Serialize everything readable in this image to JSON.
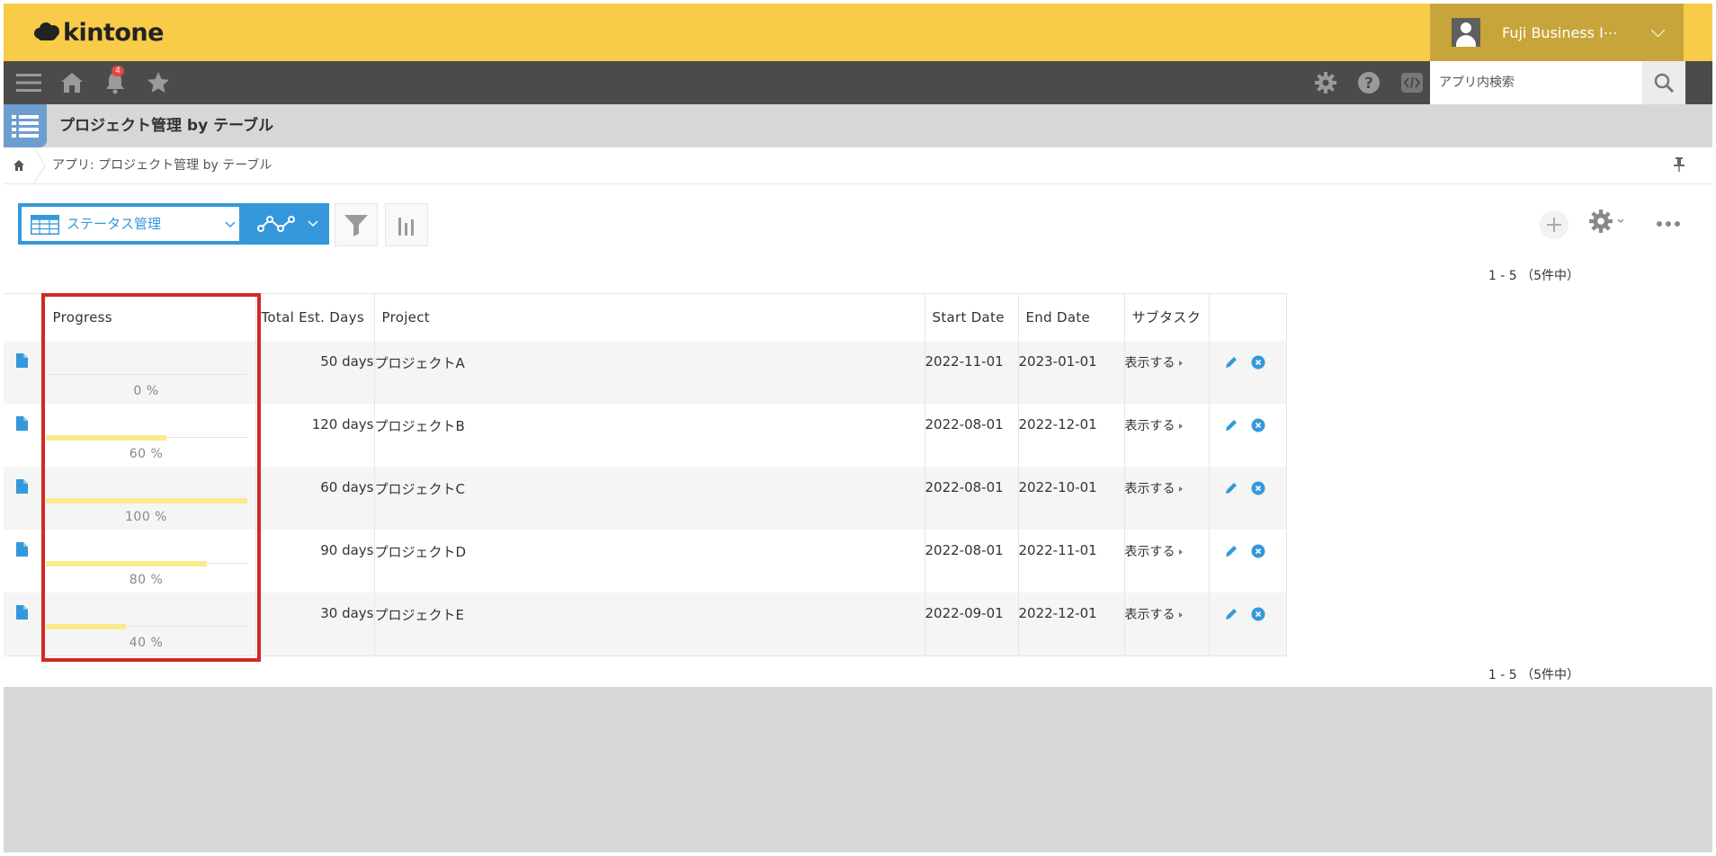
{
  "app": {
    "logo_text": "kintone",
    "user_name": "Fuji Business I⋯",
    "notification_count": "4",
    "search_placeholder": "アプリ内検索",
    "title": "プロジェクト管理 by テーブル",
    "breadcrumb": "アプリ: プロジェクト管理 by テーブル",
    "accent_color": "#3498db",
    "header_color": "#f8cb48"
  },
  "toolbar": {
    "view_label": "ステータス管理",
    "pager_top": "1 - 5 （5件中）",
    "pager_bottom": "1 - 5 （5件中）"
  },
  "table": {
    "columns": [
      "Progress",
      "Total Est. Days",
      "Project",
      "Start Date",
      "End Date",
      "サブタスク"
    ],
    "rows": [
      {
        "progress": 0,
        "progress_label": "0 %",
        "days": "50 days",
        "project": "プロジェクトA",
        "start": "2022-11-01",
        "end": "2023-01-01",
        "subtask": "表示する"
      },
      {
        "progress": 60,
        "progress_label": "60 %",
        "days": "120 days",
        "project": "プロジェクトB",
        "start": "2022-08-01",
        "end": "2022-12-01",
        "subtask": "表示する"
      },
      {
        "progress": 100,
        "progress_label": "100 %",
        "days": "60 days",
        "project": "プロジェクトC",
        "start": "2022-08-01",
        "end": "2022-10-01",
        "subtask": "表示する"
      },
      {
        "progress": 80,
        "progress_label": "80 %",
        "days": "90 days",
        "project": "プロジェクトD",
        "start": "2022-08-01",
        "end": "2022-11-01",
        "subtask": "表示する"
      },
      {
        "progress": 40,
        "progress_label": "40 %",
        "days": "30 days",
        "project": "プロジェクトE",
        "start": "2022-09-01",
        "end": "2022-12-01",
        "subtask": "表示する"
      }
    ]
  }
}
